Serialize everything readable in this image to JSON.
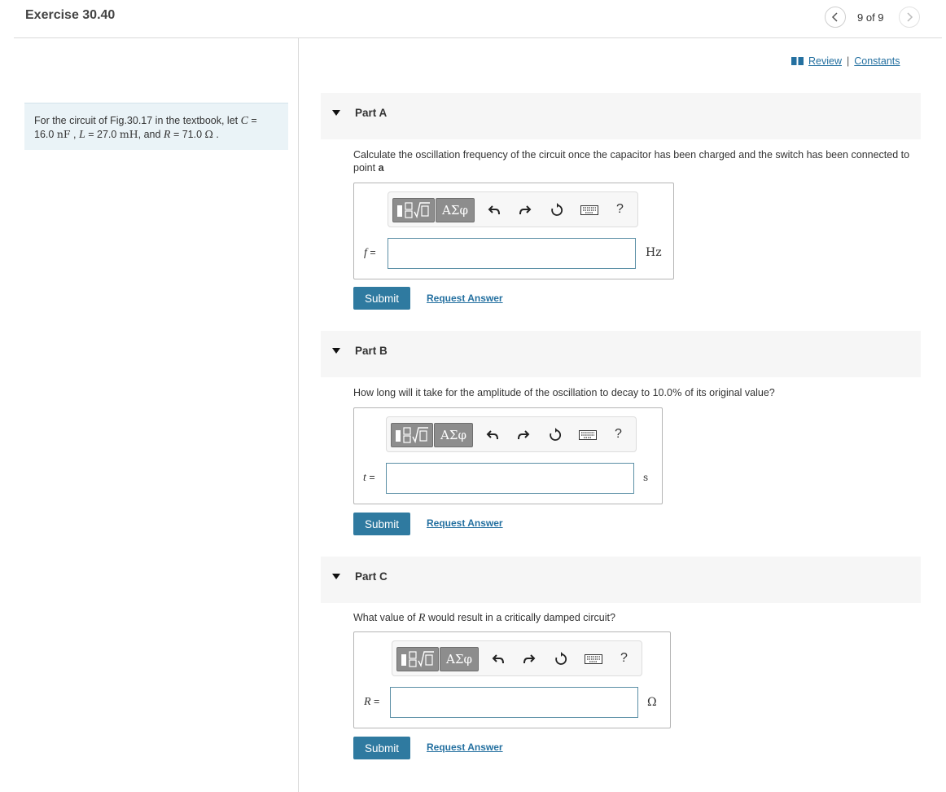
{
  "header": {
    "title": "Exercise 30.40",
    "pager": "9 of 9"
  },
  "problem": {
    "intro": "For the circuit of Fig.30.17 in the textbook, let ",
    "C_var": "C",
    "C_eq": " = ",
    "C_val": "16.0",
    "C_unit": "nF",
    "L_var": "L",
    "L_eq": " = ",
    "L_val": "27.0",
    "L_unit": "mH",
    "and": ", and ",
    "R_var": "R",
    "R_eq": " = ",
    "R_val": "71.0",
    "R_unit": "Ω",
    "end": " ."
  },
  "links": {
    "review": "Review",
    "sep": "|",
    "constants": "Constants"
  },
  "toolbar": {
    "greek": "ΑΣφ",
    "help": "?"
  },
  "parts": [
    {
      "name": "Part A",
      "question_text": "Calculate the oscillation frequency of the circuit once the capacitor has been charged and the switch has been connected to point ",
      "question_bold": "a",
      "var": "f",
      "eq": " =",
      "value": "",
      "unit": "Hz",
      "submit": "Submit",
      "request": "Request Answer"
    },
    {
      "name": "Part B",
      "question_text": "How long will it take for the amplitude of the oscillation to decay to ",
      "question_num": "10.0",
      "question_pct": "%",
      "question_end": " of its original value?",
      "var": "t",
      "eq": " =",
      "value": "",
      "unit": "s",
      "submit": "Submit",
      "request": "Request Answer"
    },
    {
      "name": "Part C",
      "question_pre": "What value of ",
      "question_var": "R",
      "question_post": " would result in a critically damped circuit?",
      "var": "R",
      "eq": " =",
      "value": "",
      "unit": "Ω",
      "submit": "Submit",
      "request": "Request Answer"
    }
  ]
}
